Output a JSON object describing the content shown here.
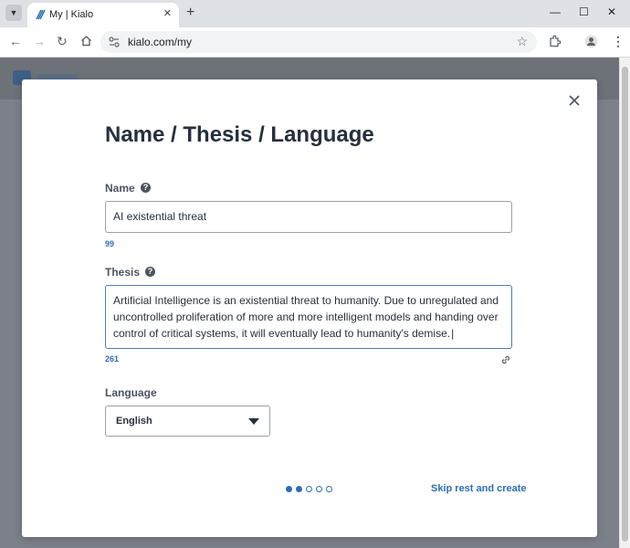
{
  "browser": {
    "tab_title": "My | Kialo",
    "tab_close": "✕",
    "new_tab": "+",
    "url": "kialo.com/my",
    "window_controls": {
      "minimize": "—",
      "maximize": "☐",
      "close": "✕"
    }
  },
  "modal": {
    "title": "Name / Thesis / Language",
    "name": {
      "label": "Name",
      "help": "?",
      "value": "AI existential threat",
      "remaining": "99"
    },
    "thesis": {
      "label": "Thesis",
      "help": "?",
      "value": "Artificial Intelligence is an existential threat to humanity. Due to unregulated and uncontrolled proliferation of more and more intelligent models and handing over control of critical systems, it will eventually lead to humanity's demise.",
      "remaining": "261"
    },
    "language": {
      "label": "Language",
      "selected": "English"
    },
    "steps": {
      "total": 5,
      "current": 2
    },
    "skip_label": "Skip rest and create"
  },
  "colors": {
    "accent": "#2a6fb6",
    "title": "#26303d",
    "label": "#4a5461"
  }
}
